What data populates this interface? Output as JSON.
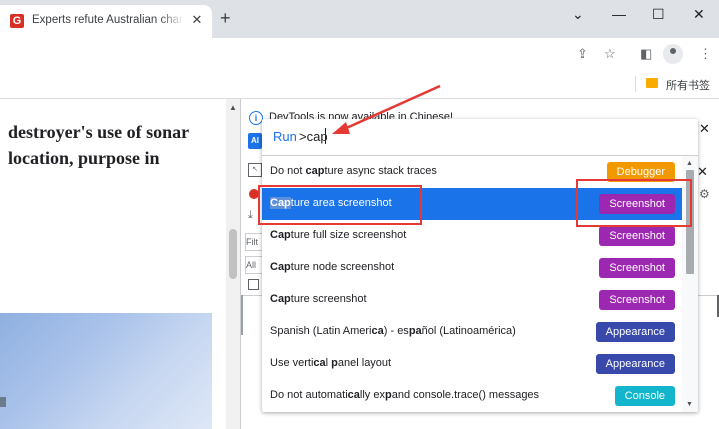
{
  "tab": {
    "favicon_letter": "G",
    "title": "Experts refute Australian char",
    "close": "✕"
  },
  "newtab": "+",
  "window_controls": {
    "dropdown": "⌄",
    "minimize": "—",
    "maximize": "☐",
    "close": "✕"
  },
  "toolbar_icons": [
    "share-icon",
    "star-icon",
    "sidepanel-icon",
    "profile-icon",
    "menu-icon"
  ],
  "toolbar": {
    "share": "⇪",
    "star": "☆",
    "sidepanel": "◧",
    "menu": "⋮"
  },
  "bookmarks": {
    "label": "所有书签"
  },
  "article": {
    "headline_line1": "destroyer's use of sonar",
    "headline_line2": "location, purpose in"
  },
  "devtools": {
    "info_icon": "i",
    "info_text": "DevTools is now available in Chinese!",
    "close": "✕",
    "filter": "Filt",
    "all": "All"
  },
  "command_menu": {
    "prompt": "Run",
    "query": ">cap",
    "items": [
      {
        "pre": "Do not ",
        "match": "cap",
        "post": "ture async stack traces",
        "badge": "Debugger",
        "badge_color": "#f29900",
        "selected": false
      },
      {
        "pre": "",
        "match": "Cap",
        "post": "ture area screenshot",
        "badge": "Screenshot",
        "badge_color": "#9c27b0",
        "selected": true
      },
      {
        "pre": "",
        "match": "Cap",
        "post": "ture full size screenshot",
        "badge": "Screenshot",
        "badge_color": "#9c27b0",
        "selected": false
      },
      {
        "pre": "",
        "match": "Cap",
        "post": "ture node screenshot",
        "badge": "Screenshot",
        "badge_color": "#9c27b0",
        "selected": false
      },
      {
        "pre": "",
        "match": "Cap",
        "post": "ture screenshot",
        "badge": "Screenshot",
        "badge_color": "#9c27b0",
        "selected": false
      },
      {
        "pre": "Spanish (Latin Ameri",
        "match": "ca",
        "post": ") - es",
        "match2": "pa",
        "post2": "ñol (Latinoamérica)",
        "badge": "Appearance",
        "badge_color": "#3949ab",
        "selected": false
      },
      {
        "pre": "Use verti",
        "match": "ca",
        "post": "l ",
        "match2": "p",
        "post2": "anel layout",
        "badge": "Appearance",
        "badge_color": "#3949ab",
        "selected": false
      },
      {
        "pre": "Do not automati",
        "match": "ca",
        "post": "lly ex",
        "match2": "p",
        "post2": "and console.trace() messages",
        "badge": "Console",
        "badge_color": "#12b5cb",
        "selected": false
      }
    ]
  },
  "colors": {
    "accent": "#1a73e8",
    "annotation_red": "#e53935"
  }
}
